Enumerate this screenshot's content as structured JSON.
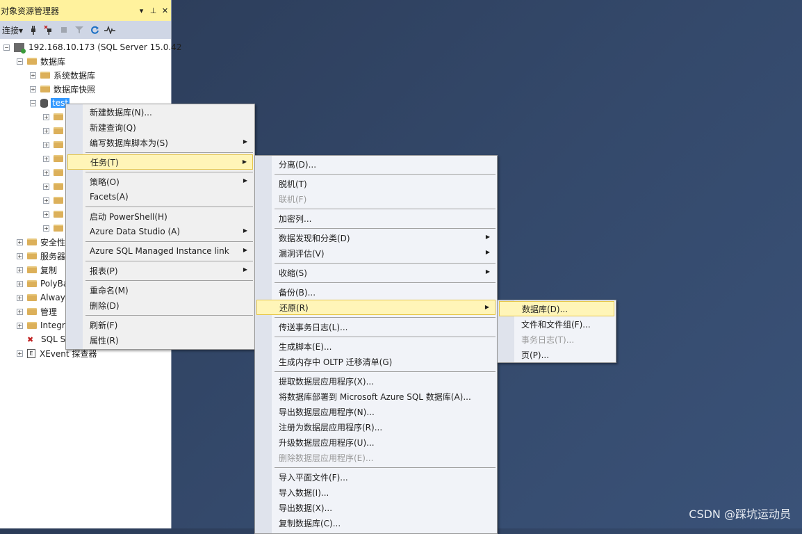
{
  "object_explorer": {
    "title": "对象资源管理器",
    "title_buttons": [
      "▾",
      "⊥",
      "✕"
    ],
    "toolbar": {
      "connect_label": "连接",
      "connect_arrow": "▾"
    },
    "tree": {
      "server": "192.168.10.173 (SQL Server 15.0.42",
      "databases": "数据库",
      "system_databases": "系统数据库",
      "database_snapshots": "数据库快照",
      "test_db": "test",
      "security": "安全性",
      "server_objects": "服务器",
      "replication": "复制",
      "polybase": "PolyBa",
      "always_on": "Alway",
      "management": "管理",
      "integration": "Integr",
      "sql_agent": "SQL S",
      "xevent": "XEvent 探查器"
    }
  },
  "context_menu": {
    "new_database": "新建数据库(N)...",
    "new_query": "新建查询(Q)",
    "script_database_as": "编写数据库脚本为(S)",
    "tasks": "任务(T)",
    "policies": "策略(O)",
    "facets": "Facets(A)",
    "start_powershell": "启动 PowerShell(H)",
    "azure_data_studio": "Azure Data Studio (A)",
    "azure_sql_mi_link": "Azure SQL Managed Instance link",
    "reports": "报表(P)",
    "rename": "重命名(M)",
    "delete": "删除(D)",
    "refresh": "刷新(F)",
    "properties": "属性(R)"
  },
  "tasks_menu": {
    "detach": "分离(D)...",
    "take_offline": "脱机(T)",
    "bring_online": "联机(F)",
    "encrypt_columns": "加密列...",
    "data_discovery": "数据发现和分类(D)",
    "vulnerability_assessment": "漏洞评估(V)",
    "shrink": "收缩(S)",
    "backup": "备份(B)...",
    "restore": "还原(R)",
    "ship_transaction_logs": "传送事务日志(L)...",
    "generate_scripts": "生成脚本(E)...",
    "generate_oltp_checklist": "生成内存中 OLTP 迁移清单(G)",
    "extract_data_tier": "提取数据层应用程序(X)...",
    "deploy_to_azure": "将数据库部署到 Microsoft Azure SQL 数据库(A)...",
    "export_data_tier": "导出数据层应用程序(N)...",
    "register_data_tier": "注册为数据层应用程序(R)...",
    "upgrade_data_tier": "升级数据层应用程序(U)...",
    "delete_data_tier": "删除数据层应用程序(E)...",
    "import_flat_file": "导入平面文件(F)...",
    "import_data": "导入数据(I)...",
    "export_data": "导出数据(X)...",
    "copy_database": "复制数据库(C)..."
  },
  "restore_menu": {
    "database": "数据库(D)...",
    "files_and_filegroups": "文件和文件组(F)...",
    "transaction_log": "事务日志(T)...",
    "page": "页(P)..."
  },
  "watermark": "CSDN @踩坑运动员"
}
